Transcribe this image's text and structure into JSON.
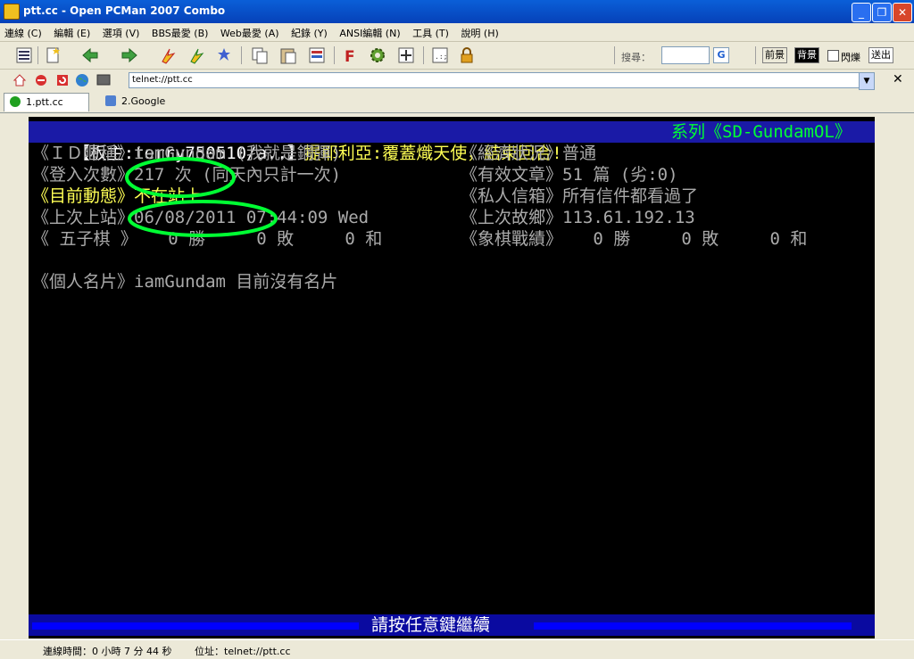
{
  "window": {
    "title": "ptt.cc - Open PCMan 2007 Combo",
    "minimize": "_",
    "maximize": "❐",
    "close": "✕"
  },
  "menu": {
    "items": [
      "連線 (C)",
      "編輯 (E)",
      "選項 (V)",
      "BBS最愛 (B)",
      "Web最愛 (A)",
      "紀錄 (Y)",
      "ANSI編輯 (N)",
      "工具 (T)",
      "說明 (H)"
    ]
  },
  "toolbar": {
    "search_label": "搜尋：",
    "g_label": "G",
    "fg_label": "前景",
    "bg_label": "背景",
    "blink_label": "閃爍",
    "send_label": "送出"
  },
  "address": {
    "value": "telnet://ptt.cc",
    "close": "✕"
  },
  "tabs": [
    {
      "label": "1.ptt.cc",
      "active": true
    },
    {
      "label": "2.Google",
      "active": false
    }
  ],
  "terminal": {
    "header_left": "【板主:terry750510/a..】",
    "header_mid": "提耶利亞:覆蓋熾天使，結束回合!",
    "header_right": "系列《SD-GundamOL》",
    "rows": [
      {
        "left_label": "《ＩＤ暱稱》",
        "left_value": "iamGundam (我就是鋼彈)",
        "right_label": "《經濟狀況》",
        "right_value": "普通"
      },
      {
        "left_label": "《登入次數》",
        "left_value": "217 次 (同天內只計一次)",
        "right_label": "《有效文章》",
        "right_value": "51 篇 (劣:0)"
      },
      {
        "left_label": "《目前動態》",
        "left_value": "不在站上",
        "right_label": "《私人信箱》",
        "right_value": "所有信件都看過了"
      },
      {
        "left_label": "《上次上站》",
        "left_value": "06/08/2011 07:44:09 Wed",
        "right_label": "《上次故鄉》",
        "right_value": "113.61.192.13"
      },
      {
        "left_label": "《 五子棋 》",
        "left_value": "   0 勝     0 敗     0 和",
        "right_label": "《象棋戰績》",
        "right_value": "   0 勝     0 敗     0 和"
      }
    ],
    "card_label": "《個人名片》",
    "card_value": "iamGundam 目前沒有名片",
    "footer": "請按任意鍵繼續"
  },
  "status": {
    "connect_time": "連線時間：0 小時 7 分 44 秒",
    "location": "位址：telnet://ptt.cc"
  },
  "colors": {
    "header_bg": "#1a1aa6",
    "highlight_circle": "#00ff33",
    "footer_bg": "#0a0aa0"
  }
}
